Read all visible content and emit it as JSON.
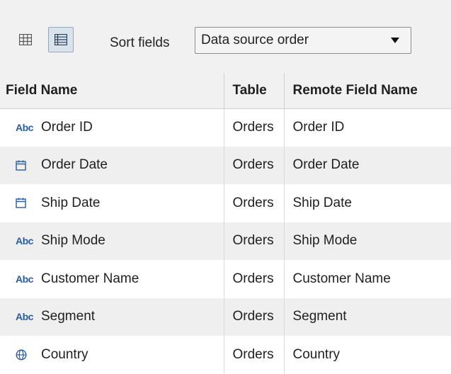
{
  "toolbar": {
    "sort_label": "Sort fields",
    "sort_value": "Data source order",
    "grid_icon": "grid-view-icon",
    "list_icon": "list-view-icon"
  },
  "table": {
    "headers": [
      "Field Name",
      "Table",
      "Remote Field Name"
    ],
    "rows": [
      {
        "type_icon": "abc-string-icon",
        "type_text": "Abc",
        "field": "Order ID",
        "table": "Orders",
        "remote": "Order ID"
      },
      {
        "type_icon": "calendar-icon",
        "type_text": "",
        "field": "Order Date",
        "table": "Orders",
        "remote": "Order Date"
      },
      {
        "type_icon": "calendar-icon",
        "type_text": "",
        "field": "Ship Date",
        "table": "Orders",
        "remote": "Ship Date"
      },
      {
        "type_icon": "abc-string-icon",
        "type_text": "Abc",
        "field": "Ship Mode",
        "table": "Orders",
        "remote": "Ship Mode"
      },
      {
        "type_icon": "abc-string-icon",
        "type_text": "Abc",
        "field": "Customer Name",
        "table": "Orders",
        "remote": "Customer Name"
      },
      {
        "type_icon": "abc-string-icon",
        "type_text": "Abc",
        "field": "Segment",
        "table": "Orders",
        "remote": "Segment"
      },
      {
        "type_icon": "globe-icon",
        "type_text": "",
        "field": "Country",
        "table": "Orders",
        "remote": "Country"
      }
    ]
  },
  "colors": {
    "icon_blue": "#2a5ca0",
    "header_bg": "#f1f1f1",
    "alt_row_bg": "#efefef"
  }
}
